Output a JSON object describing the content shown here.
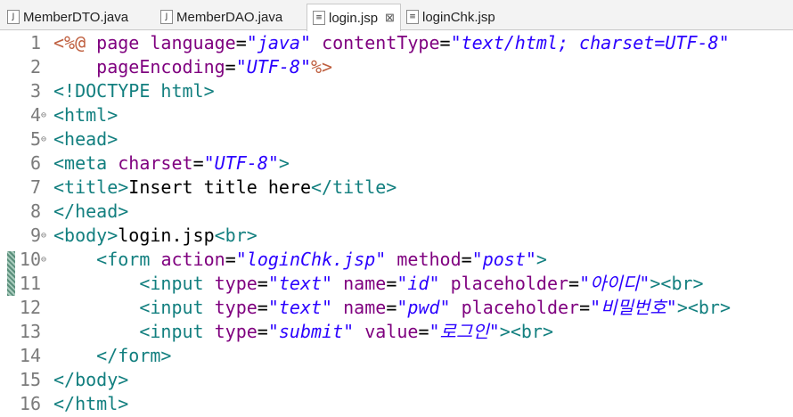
{
  "tabs": [
    {
      "label": "MemberDTO.java",
      "icon": "java-file-icon",
      "active": false
    },
    {
      "label": "MemberDAO.java",
      "icon": "java-file-icon",
      "active": false
    },
    {
      "label": "login.jsp",
      "icon": "jsp-file-icon",
      "active": true
    },
    {
      "label": "loginChk.jsp",
      "icon": "jsp-file-icon",
      "active": false
    }
  ],
  "close_glyph": "⊠",
  "lines": [
    {
      "n": "1",
      "tokens": [
        [
          "dir",
          "<%@"
        ],
        [
          "txt",
          " "
        ],
        [
          "attr",
          "page"
        ],
        [
          "txt",
          " "
        ],
        [
          "attr",
          "language"
        ],
        [
          "txt",
          "="
        ],
        [
          "val",
          "\"java\""
        ],
        [
          "txt",
          " "
        ],
        [
          "attr",
          "contentType"
        ],
        [
          "txt",
          "="
        ],
        [
          "val",
          "\"text/html; charset=UTF-8\""
        ]
      ]
    },
    {
      "n": "2",
      "tokens": [
        [
          "txt",
          "    "
        ],
        [
          "attr",
          "pageEncoding"
        ],
        [
          "txt",
          "="
        ],
        [
          "val",
          "\"UTF-8\""
        ],
        [
          "dir",
          "%>"
        ]
      ]
    },
    {
      "n": "3",
      "tokens": [
        [
          "tag",
          "<!DOCTYPE html>"
        ]
      ]
    },
    {
      "n": "4",
      "fold": true,
      "tokens": [
        [
          "tag",
          "<html>"
        ]
      ]
    },
    {
      "n": "5",
      "fold": true,
      "tokens": [
        [
          "tag",
          "<head>"
        ]
      ]
    },
    {
      "n": "6",
      "tokens": [
        [
          "tag",
          "<meta"
        ],
        [
          "txt",
          " "
        ],
        [
          "attr",
          "charset"
        ],
        [
          "txt",
          "="
        ],
        [
          "val",
          "\"UTF-8\""
        ],
        [
          "tag",
          ">"
        ]
      ]
    },
    {
      "n": "7",
      "tokens": [
        [
          "tag",
          "<title>"
        ],
        [
          "txt",
          "Insert title here"
        ],
        [
          "tag",
          "</title>"
        ]
      ]
    },
    {
      "n": "8",
      "tokens": [
        [
          "tag",
          "</head>"
        ]
      ]
    },
    {
      "n": "9",
      "fold": true,
      "tokens": [
        [
          "tag",
          "<body>"
        ],
        [
          "txt",
          "login.jsp"
        ],
        [
          "tag",
          "<br>"
        ]
      ]
    },
    {
      "n": "10",
      "fold": true,
      "tokens": [
        [
          "txt",
          "    "
        ],
        [
          "tag",
          "<form"
        ],
        [
          "txt",
          " "
        ],
        [
          "attr",
          "action"
        ],
        [
          "txt",
          "="
        ],
        [
          "val",
          "\"loginChk.jsp\""
        ],
        [
          "txt",
          " "
        ],
        [
          "attr",
          "method"
        ],
        [
          "txt",
          "="
        ],
        [
          "val",
          "\"post\""
        ],
        [
          "tag",
          ">"
        ]
      ]
    },
    {
      "n": "11",
      "tokens": [
        [
          "txt",
          "        "
        ],
        [
          "tag",
          "<input"
        ],
        [
          "txt",
          " "
        ],
        [
          "attr",
          "type"
        ],
        [
          "txt",
          "="
        ],
        [
          "val",
          "\"text\""
        ],
        [
          "txt",
          " "
        ],
        [
          "attr",
          "name"
        ],
        [
          "txt",
          "="
        ],
        [
          "val",
          "\"id\""
        ],
        [
          "txt",
          " "
        ],
        [
          "attr",
          "placeholder"
        ],
        [
          "txt",
          "="
        ],
        [
          "val",
          "\"아이디\""
        ],
        [
          "tag",
          "><br>"
        ]
      ]
    },
    {
      "n": "12",
      "tokens": [
        [
          "txt",
          "        "
        ],
        [
          "tag",
          "<input"
        ],
        [
          "txt",
          " "
        ],
        [
          "attr",
          "type"
        ],
        [
          "txt",
          "="
        ],
        [
          "val",
          "\"text\""
        ],
        [
          "txt",
          " "
        ],
        [
          "attr",
          "name"
        ],
        [
          "txt",
          "="
        ],
        [
          "val",
          "\"pwd\""
        ],
        [
          "txt",
          " "
        ],
        [
          "attr",
          "placeholder"
        ],
        [
          "txt",
          "="
        ],
        [
          "val",
          "\"비밀번호\""
        ],
        [
          "tag",
          "><br>"
        ]
      ]
    },
    {
      "n": "13",
      "tokens": [
        [
          "txt",
          "        "
        ],
        [
          "tag",
          "<input"
        ],
        [
          "txt",
          " "
        ],
        [
          "attr",
          "type"
        ],
        [
          "txt",
          "="
        ],
        [
          "val",
          "\"submit\""
        ],
        [
          "txt",
          " "
        ],
        [
          "attr",
          "value"
        ],
        [
          "txt",
          "="
        ],
        [
          "val",
          "\"로그인\""
        ],
        [
          "tag",
          "><br>"
        ]
      ]
    },
    {
      "n": "14",
      "tokens": [
        [
          "txt",
          "    "
        ],
        [
          "tag",
          "</form>"
        ]
      ]
    },
    {
      "n": "15",
      "tokens": [
        [
          "tag",
          "</body>"
        ]
      ]
    },
    {
      "n": "16",
      "tokens": [
        [
          "tag",
          "</html>"
        ]
      ]
    }
  ]
}
